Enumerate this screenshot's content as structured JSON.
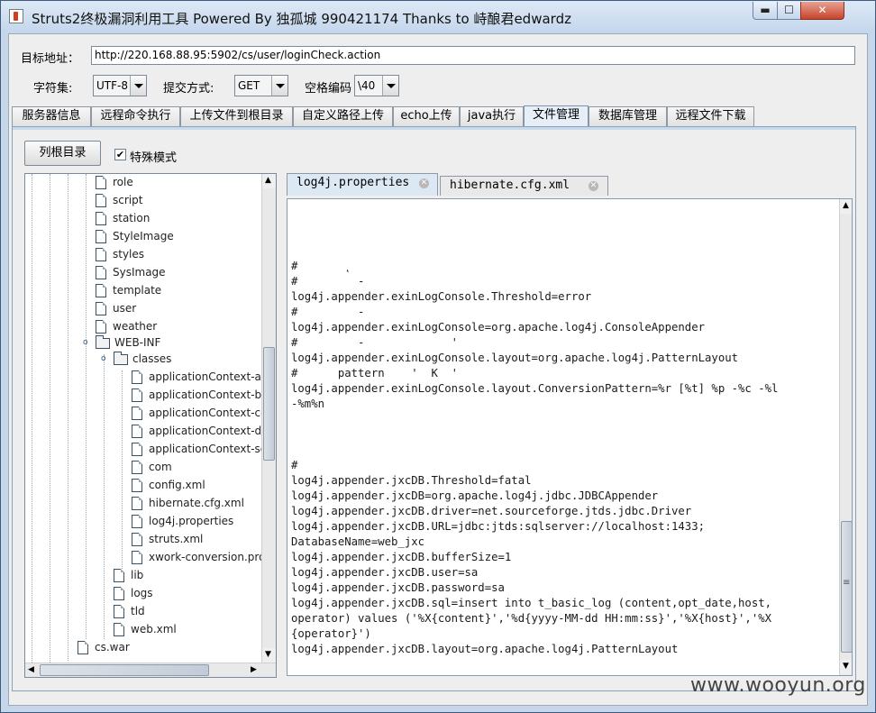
{
  "window": {
    "title": "Struts2终极漏洞利用工具  Powered By 独孤城 990421174 Thanks to 峙酿君edwardz",
    "min_glyph": "▬",
    "max_glyph": "☐",
    "close_glyph": "✕"
  },
  "form": {
    "target_label": "目标地址：",
    "target_value": "http://220.168.88.95:5902/cs/user/loginCheck.action",
    "charset_label": "字符集:",
    "charset_value": "UTF-8",
    "method_label": "提交方式:",
    "method_value": "GET",
    "space_label": "空格编码",
    "space_value": "\\40"
  },
  "tabs": [
    "服务器信息",
    "远程命令执行",
    "上传文件到根目录",
    "自定义路径上传",
    "echo上传",
    "java执行",
    "文件管理",
    "数据库管理",
    "远程文件下载"
  ],
  "active_tab": "文件管理",
  "file_manager": {
    "list_root_label": "列根目录",
    "special_mode_label": "特殊模式",
    "special_mode_checked": true,
    "check_glyph": "✔"
  },
  "tree": {
    "nodes": [
      {
        "label": "role",
        "type": "file"
      },
      {
        "label": "script",
        "type": "file"
      },
      {
        "label": "station",
        "type": "file"
      },
      {
        "label": "StyleImage",
        "type": "file"
      },
      {
        "label": "styles",
        "type": "file"
      },
      {
        "label": "SysImage",
        "type": "file"
      },
      {
        "label": "template",
        "type": "file"
      },
      {
        "label": "user",
        "type": "file"
      },
      {
        "label": "weather",
        "type": "file"
      },
      {
        "label": "WEB-INF",
        "type": "folder"
      },
      {
        "label": "classes",
        "type": "folder"
      },
      {
        "label": "applicationContext-act",
        "type": "file"
      },
      {
        "label": "applicationContext-bea",
        "type": "file"
      },
      {
        "label": "applicationContext-cor",
        "type": "file"
      },
      {
        "label": "applicationContext-dao",
        "type": "file"
      },
      {
        "label": "applicationContext-ser",
        "type": "file"
      },
      {
        "label": "com",
        "type": "file"
      },
      {
        "label": "config.xml",
        "type": "file"
      },
      {
        "label": "hibernate.cfg.xml",
        "type": "file"
      },
      {
        "label": "log4j.properties",
        "type": "file"
      },
      {
        "label": "struts.xml",
        "type": "file"
      },
      {
        "label": "xwork-conversion.prop",
        "type": "file"
      },
      {
        "label": "lib",
        "type": "file"
      },
      {
        "label": "logs",
        "type": "file"
      },
      {
        "label": "tld",
        "type": "file"
      },
      {
        "label": "web.xml",
        "type": "file"
      },
      {
        "label": "cs.war",
        "type": "file"
      }
    ]
  },
  "editor": {
    "tabs": [
      {
        "label": "log4j.properties",
        "active": true
      },
      {
        "label": "hibernate.cfg.xml",
        "active": false
      }
    ],
    "content": "#       ˛\n#         -\nlog4j.appender.exinLogConsole.Threshold=error\n#         -\nlog4j.appender.exinLogConsole=org.apache.log4j.ConsoleAppender\n#         -             '\nlog4j.appender.exinLogConsole.layout=org.apache.log4j.PatternLayout\n#      pattern    '  K  '\nlog4j.appender.exinLogConsole.layout.ConversionPattern=%r [%t] %p -%c -%l\n-%m%n\n\n\n\n#\nlog4j.appender.jxcDB.Threshold=fatal\nlog4j.appender.jxcDB=org.apache.log4j.jdbc.JDBCAppender\nlog4j.appender.jxcDB.driver=net.sourceforge.jtds.jdbc.Driver\nlog4j.appender.jxcDB.URL=jdbc:jtds:sqlserver://localhost:1433;\nDatabaseName=web_jxc\nlog4j.appender.jxcDB.bufferSize=1\nlog4j.appender.jxcDB.user=sa\nlog4j.appender.jxcDB.password=sa\nlog4j.appender.jxcDB.sql=insert into t_basic_log (content,opt_date,host,\noperator) values ('%X{content}','%d{yyyy-MM-dd HH:mm:ss}','%X{host}','%X\n{operator}')\nlog4j.appender.jxcDB.layout=org.apache.log4j.PatternLayout"
  },
  "watermark": "www.wooyun.org",
  "scroll_glyphs": {
    "up": "▲",
    "down": "▼",
    "left": "◀",
    "right": "▶",
    "grip": "≡"
  },
  "colors": {
    "accent": "#c6d7ea",
    "close": "#c6442c"
  }
}
